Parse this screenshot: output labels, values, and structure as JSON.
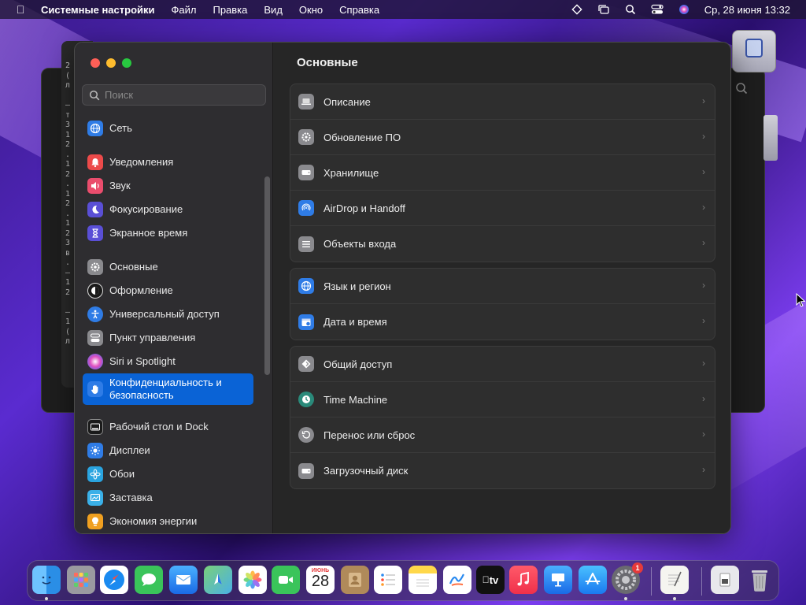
{
  "menubar": {
    "app_name": "Системные настройки",
    "menus": [
      "Файл",
      "Правка",
      "Вид",
      "Окно",
      "Справка"
    ],
    "clock": "Ср, 28 июня  13:32"
  },
  "background_window": {
    "text_lines": "2\n(\nл\n\n–\nт\nЗ\n1\n2\n.\n1\n2\n.\n1\n2\n.\n1\n2\n3\nв\n.\n–\n1\n2\n\n–\n1\n(\nл"
  },
  "search": {
    "placeholder": "Поиск"
  },
  "sidebar": {
    "items": [
      {
        "label": "Сеть",
        "icon": "globe-icon",
        "color": "#2f7ce6"
      },
      {
        "label": "Уведомления",
        "icon": "bell-icon",
        "color": "#ec4a4a"
      },
      {
        "label": "Звук",
        "icon": "speaker-icon",
        "color": "#ea4d6d"
      },
      {
        "label": "Фокусирование",
        "icon": "moon-icon",
        "color": "#5a4fd6"
      },
      {
        "label": "Экранное время",
        "icon": "hourglass-icon",
        "color": "#5a4fd6"
      },
      {
        "label": "Основные",
        "icon": "gear-icon",
        "color": "#8a8a8e"
      },
      {
        "label": "Оформление",
        "icon": "appearance-icon",
        "color": "#1a1a1a"
      },
      {
        "label": "Универсальный доступ",
        "icon": "accessibility-icon",
        "color": "#2f7ce6"
      },
      {
        "label": "Пункт управления",
        "icon": "control-center-icon",
        "color": "#8a8a8e"
      },
      {
        "label": "Siri и Spotlight",
        "icon": "siri-icon",
        "color": "#7b4fe0"
      },
      {
        "label": "Конфиденциальность и безопасность",
        "icon": "hand-icon",
        "color": "#2f7ce6"
      },
      {
        "label": "Рабочий стол и Dock",
        "icon": "dock-icon",
        "color": "#1a1a1a"
      },
      {
        "label": "Дисплеи",
        "icon": "sun-icon",
        "color": "#2f7ce6"
      },
      {
        "label": "Обои",
        "icon": "flower-icon",
        "color": "#2aa4e0"
      },
      {
        "label": "Заставка",
        "icon": "screensaver-icon",
        "color": "#3ab0e8"
      },
      {
        "label": "Экономия энергии",
        "icon": "bulb-icon",
        "color": "#f0a020"
      }
    ]
  },
  "content": {
    "title": "Основные",
    "groups": [
      {
        "rows": [
          {
            "label": "Описание",
            "icon": "laptop-icon",
            "color": "#8a8a8e"
          },
          {
            "label": "Обновление ПО",
            "icon": "gear-badge-icon",
            "color": "#8a8a8e"
          },
          {
            "label": "Хранилище",
            "icon": "drive-icon",
            "color": "#8a8a8e"
          },
          {
            "label": "AirDrop и Handoff",
            "icon": "airdrop-icon",
            "color": "#2f7ce6"
          },
          {
            "label": "Объекты входа",
            "icon": "list-icon",
            "color": "#8a8a8e"
          }
        ]
      },
      {
        "rows": [
          {
            "label": "Язык и регион",
            "icon": "globe-icon",
            "color": "#2f7ce6"
          },
          {
            "label": "Дата и время",
            "icon": "calendar-clock-icon",
            "color": "#2f7ce6"
          }
        ]
      },
      {
        "rows": [
          {
            "label": "Общий доступ",
            "icon": "sharing-icon",
            "color": "#8a8a8e"
          },
          {
            "label": "Time Machine",
            "icon": "time-machine-icon",
            "color": "#2a8a7a"
          },
          {
            "label": "Перенос или сброс",
            "icon": "reset-icon",
            "color": "#8a8a8e"
          },
          {
            "label": "Загрузочный диск",
            "icon": "disk-icon",
            "color": "#8a8a8e"
          }
        ]
      }
    ]
  },
  "dock": {
    "calendar_month": "ИЮНЬ",
    "calendar_day": "28",
    "tv_label": "tv",
    "settings_badge": "1",
    "apps": [
      "finder-icon",
      "launchpad-icon",
      "safari-icon",
      "messages-icon",
      "mail-icon",
      "maps-icon",
      "photos-icon",
      "facetime-icon",
      "calendar-icon",
      "contacts-icon",
      "reminders-icon",
      "notes-icon",
      "freeform-icon",
      "tv-icon",
      "music-icon",
      "keynote-icon",
      "app-store-icon",
      "system-settings-icon",
      "textedit-icon",
      "preview-icon",
      "trash-icon"
    ]
  }
}
